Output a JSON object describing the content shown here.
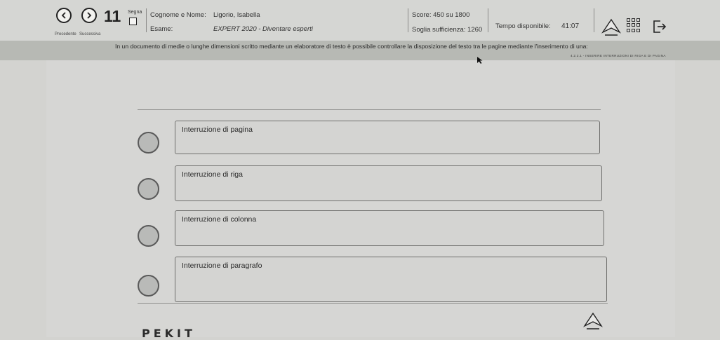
{
  "header": {
    "prev_label": "Precedente",
    "next_label": "Successiva",
    "question_number": "11",
    "segna_label": "Segna",
    "candidate_label": "Cognome e Nome:",
    "candidate_name": "Ligorio, Isabella",
    "exam_label": "Esame:",
    "exam_name": "EXPERT 2020 - Diventare esperti",
    "score_text": "Score: 450 su 1800",
    "threshold_text": "Soglia sufficienza: 1260",
    "time_label": "Tempo disponibile:",
    "time_value": "41:07",
    "icons": {
      "prev": "chevron-left-icon",
      "next": "chevron-right-icon",
      "flag": "checkbox-icon",
      "tools": "pen-tool-icon",
      "overview": "grid-icon",
      "exit": "exit-icon"
    }
  },
  "question": {
    "text": "In un documento di medie o lunghe dimensioni scritto mediante un elaboratore di testo è possibile controllare la disposizione del testo tra le pagine mediante l'inserimento di una:",
    "reference": "4.2.2.1 - INSERIRE INTERRUZIONI DI RIGA E DI PAGINA"
  },
  "options": [
    {
      "label": "Interruzione di pagina"
    },
    {
      "label": "Interruzione di riga"
    },
    {
      "label": "Interruzione di colonna"
    },
    {
      "label": "Interruzione di paragrafo"
    }
  ],
  "footer": {
    "brand_text": "PEKIT"
  },
  "colors": {
    "background": "#d3d3d0",
    "question_band": "#b7b9b4",
    "radio_fill": "#b9bab8"
  }
}
